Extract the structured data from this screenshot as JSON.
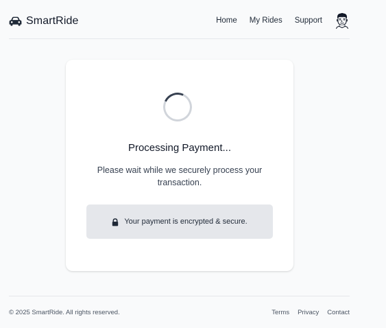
{
  "header": {
    "brand_name": "SmartRide",
    "brand_icon": "car-icon",
    "nav": {
      "home": "Home",
      "my_rides": "My Rides",
      "support": "Support"
    },
    "avatar_icon": "user-avatar"
  },
  "main": {
    "spinner_icon": "loading-spinner",
    "title": "Processing Payment...",
    "message": "Please wait while we securely process your transaction.",
    "secure_note": {
      "icon": "lock-icon",
      "text": "Your payment is encrypted & secure."
    }
  },
  "footer": {
    "copyright": "© 2025 SmartRide. All rights reserved.",
    "links": {
      "terms": "Terms",
      "privacy": "Privacy",
      "contact": "Contact"
    }
  },
  "colors": {
    "page_background": "#f9fafb",
    "card_background": "#ffffff",
    "secure_box_background": "#e5e7eb",
    "spinner_track": "#d1d5db",
    "spinner_active": "#374151",
    "text_primary": "#111827"
  }
}
